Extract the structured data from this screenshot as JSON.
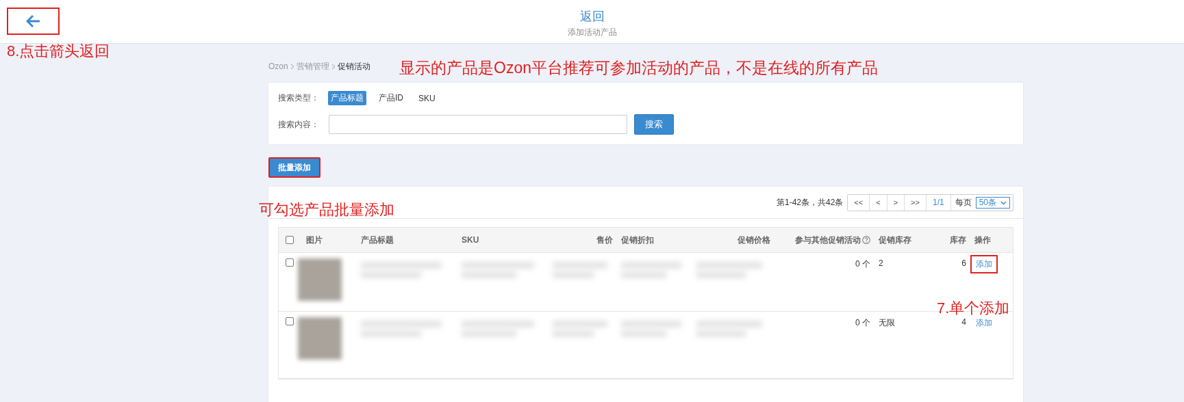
{
  "header": {
    "back_highlighted": true,
    "title": "返回",
    "subtitle": "添加活动产品"
  },
  "breadcrumb": [
    "Ozon",
    "营销管理",
    "促销活动"
  ],
  "search": {
    "type_label": "搜索类型：",
    "types": [
      {
        "label": "产品标题",
        "selected": true
      },
      {
        "label": "产品ID",
        "selected": false
      },
      {
        "label": "SKU",
        "selected": false
      }
    ],
    "content_label": "搜索内容：",
    "button": "搜索"
  },
  "batch_button": {
    "label": "批量添加",
    "highlighted": true
  },
  "pagination": {
    "summary": "第1-42条，共42条",
    "buttons": [
      "<<",
      "<",
      ">",
      ">>"
    ],
    "page": "1/1",
    "per_page_label": "每页",
    "per_page": "50条"
  },
  "table": {
    "header_checked": false,
    "columns": [
      "图片",
      "产品标题",
      "SKU",
      "售价",
      "促销折扣",
      "促销价格",
      "参与其他促销活动",
      "促销库存",
      "库存",
      "操作"
    ],
    "rows": [
      {
        "checked": false,
        "other_promotions": "0 个",
        "promo_stock": "2",
        "stock": "6",
        "action": "添加",
        "action_highlighted": true
      },
      {
        "checked": false,
        "other_promotions": "0 个",
        "promo_stock": "无限",
        "stock": "4",
        "action": "添加",
        "action_highlighted": false
      }
    ]
  },
  "annotations": [
    {
      "kind": "back",
      "text": "8.点击箭头返回"
    },
    {
      "kind": "breadcrumb",
      "text": "显示的产品是Ozon平台推荐可参加活动的产品，不是在线的所有产品"
    },
    {
      "kind": "batch",
      "text": "可勾选产品批量添加"
    },
    {
      "kind": "row_action",
      "text": "7.单个添加"
    }
  ]
}
